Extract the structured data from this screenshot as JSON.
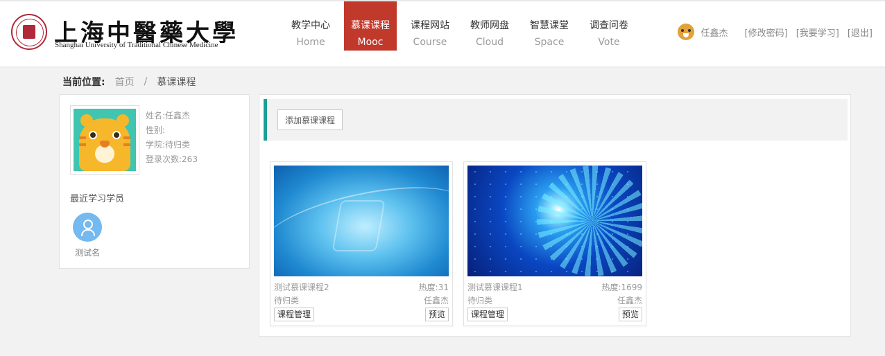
{
  "header": {
    "logo_cn": "上海中醫藥大學",
    "logo_en": "Shanghai University of Traditional Chinese Medicine",
    "nav": [
      {
        "cn": "教学中心",
        "en": "Home"
      },
      {
        "cn": "慕课课程",
        "en": "Mooc"
      },
      {
        "cn": "课程网站",
        "en": "Course"
      },
      {
        "cn": "教师网盘",
        "en": "Cloud"
      },
      {
        "cn": "智慧课堂",
        "en": "Space"
      },
      {
        "cn": "调查问卷",
        "en": "Vote"
      }
    ],
    "active_color": "#c0392b",
    "user_name": "任鑫杰",
    "links": [
      "[修改密码]",
      "[我要学习]",
      "[退出]"
    ]
  },
  "breadcrumb": {
    "label": "当前位置:",
    "home": "首页",
    "sep": "/",
    "current": "慕课课程"
  },
  "profile": {
    "name": "姓名:任鑫杰",
    "gender": "性别:",
    "college": "学院:待归类",
    "logins": "登录次数:263",
    "recent_title": "最近学习学员",
    "learners": [
      {
        "name": "测试名"
      }
    ]
  },
  "toolbar": {
    "add_label": "添加慕课课程",
    "accent": "#1aa094"
  },
  "courses": [
    {
      "title": "测试慕课课程2",
      "heat": "热度:31",
      "category": "待归类",
      "teacher": "任鑫杰",
      "manage_label": "课程管理",
      "preview_label": "预览"
    },
    {
      "title": "测试慕课课程1",
      "heat": "热度:1699",
      "category": "待归类",
      "teacher": "任鑫杰",
      "manage_label": "课程管理",
      "preview_label": "预览"
    }
  ]
}
